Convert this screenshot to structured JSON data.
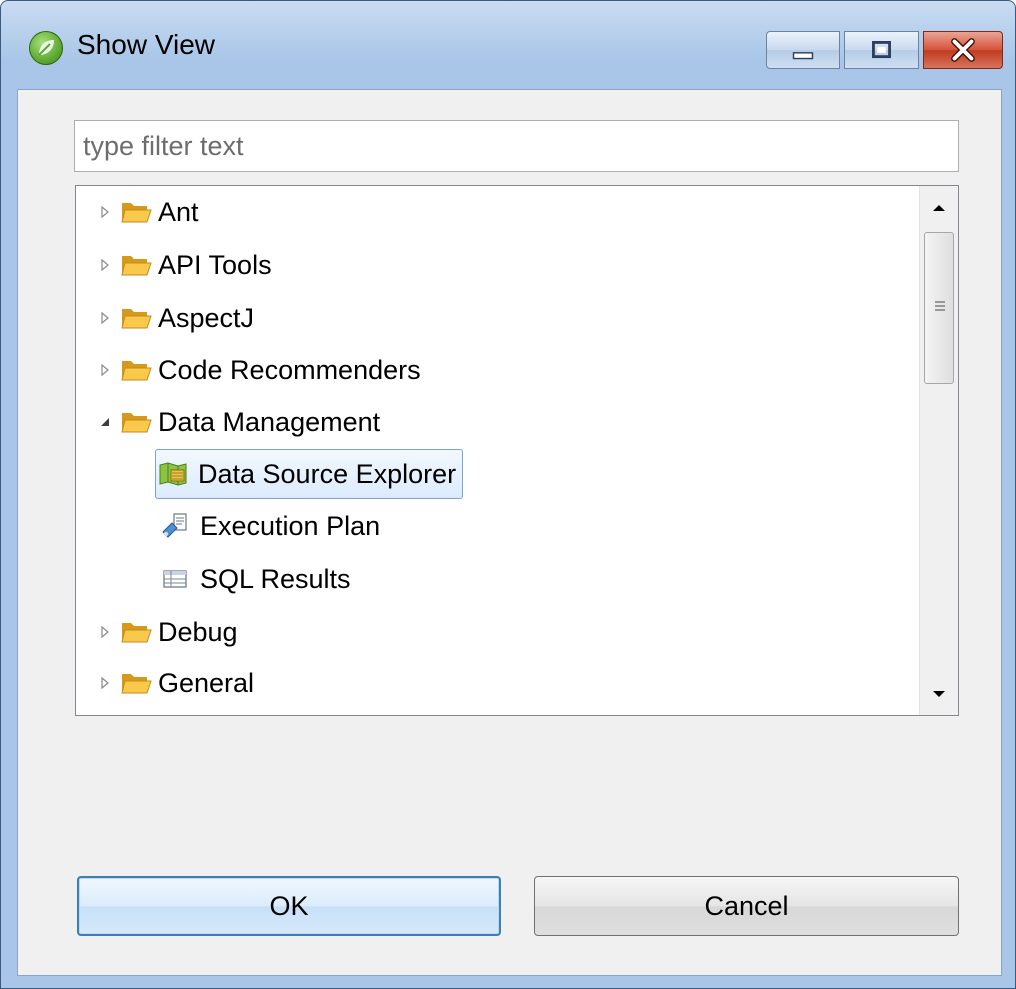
{
  "window": {
    "title": "Show View",
    "icon": "spring-leaf-icon"
  },
  "filter": {
    "placeholder": "type filter text",
    "value": ""
  },
  "tree": {
    "items": [
      {
        "label": "Ant",
        "type": "folder",
        "expanded": false
      },
      {
        "label": "API Tools",
        "type": "folder",
        "expanded": false
      },
      {
        "label": "AspectJ",
        "type": "folder",
        "expanded": false
      },
      {
        "label": "Code Recommenders",
        "type": "folder",
        "expanded": false
      },
      {
        "label": "Data Management",
        "type": "folder",
        "expanded": true,
        "children": [
          {
            "label": "Data Source Explorer",
            "icon": "data-source-explorer-icon",
            "selected": true
          },
          {
            "label": "Execution Plan",
            "icon": "execution-plan-icon",
            "selected": false
          },
          {
            "label": "SQL Results",
            "icon": "sql-results-icon",
            "selected": false
          }
        ]
      },
      {
        "label": "Debug",
        "type": "folder",
        "expanded": false
      },
      {
        "label": "General",
        "type": "folder",
        "expanded": false
      }
    ]
  },
  "buttons": {
    "ok_label": "OK",
    "cancel_label": "Cancel"
  },
  "colors": {
    "selection_border": "#7da2ce",
    "close_button": "#c03b20",
    "folder": "#f2b62c"
  }
}
